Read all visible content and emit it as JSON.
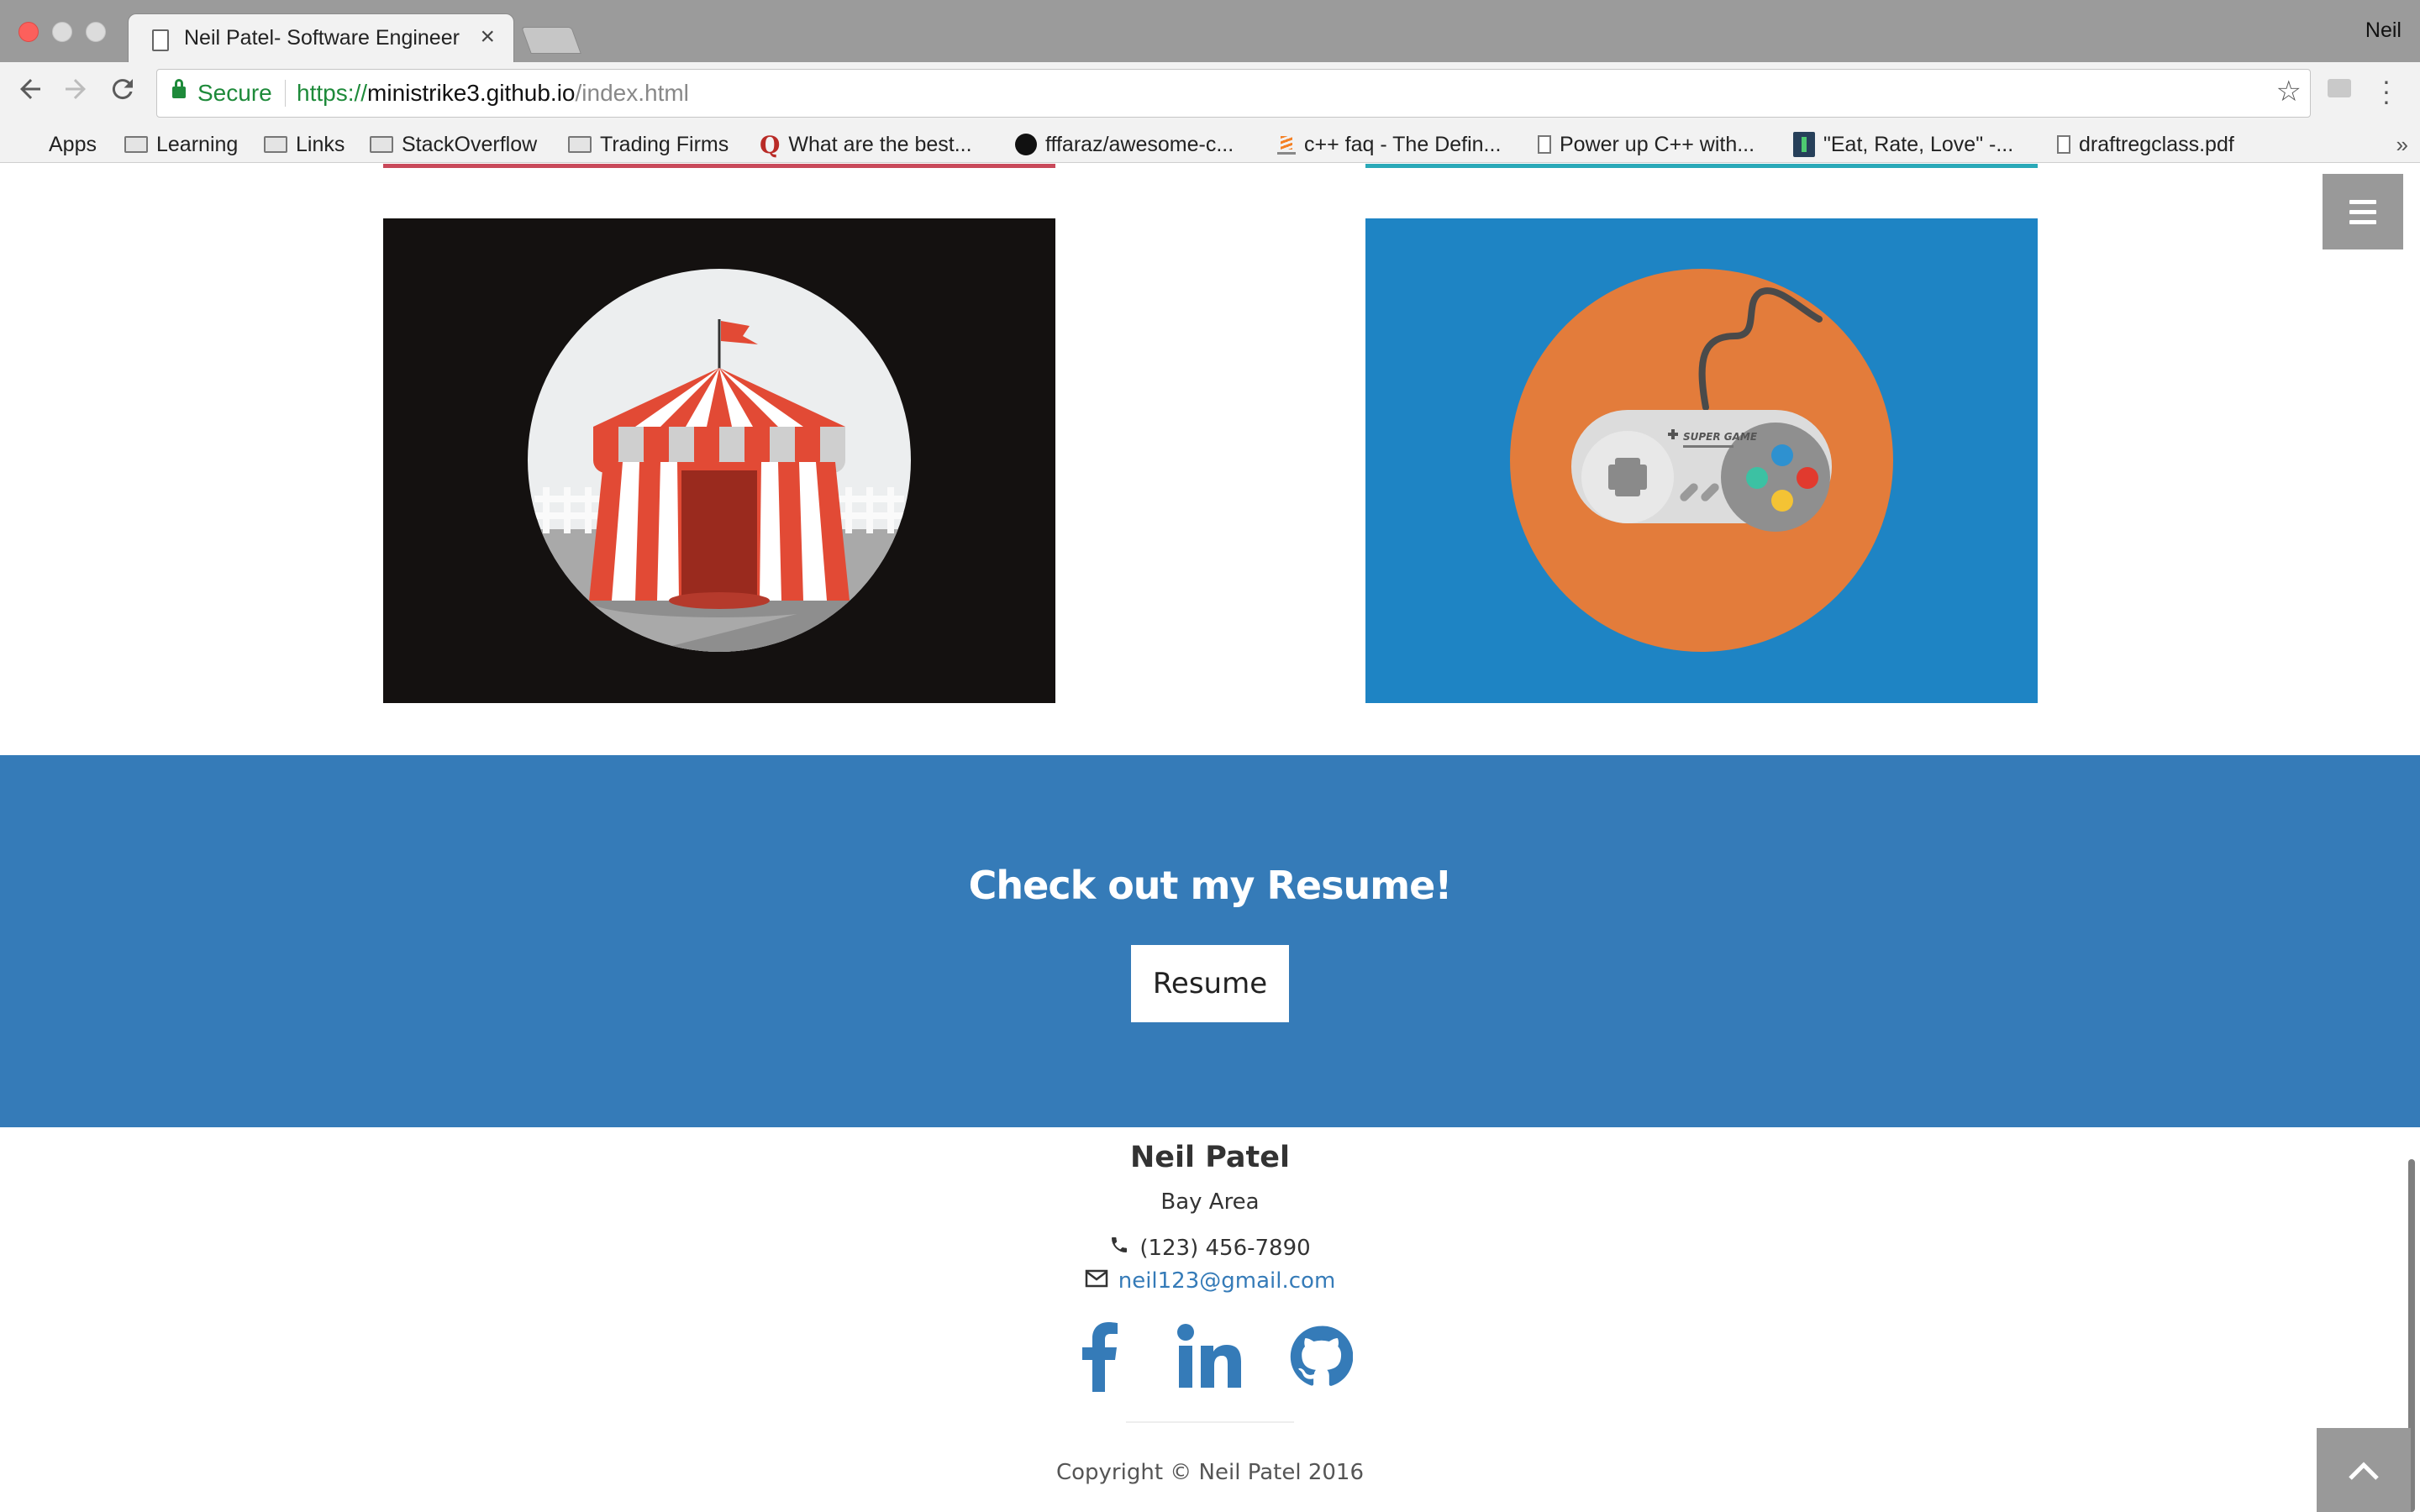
{
  "browser": {
    "tab_title": "Neil Patel- Software Engineer",
    "tab_close": "×",
    "profile_name": "Neil",
    "secure_label": "Secure",
    "url_scheme": "https://",
    "url_host": "ministrike3.github.io",
    "url_path": "/index.html",
    "bookmarks": [
      {
        "label": "Apps",
        "icon": "apps-grid-icon"
      },
      {
        "label": "Learning",
        "icon": "folder-icon"
      },
      {
        "label": "Links",
        "icon": "folder-icon"
      },
      {
        "label": "StackOverflow",
        "icon": "folder-icon"
      },
      {
        "label": "Trading Firms",
        "icon": "folder-icon"
      },
      {
        "label": "What are the best...",
        "icon": "quora-icon"
      },
      {
        "label": "fffaraz/awesome-c...",
        "icon": "github-icon"
      },
      {
        "label": "c++ faq - The Defin...",
        "icon": "stackoverflow-icon"
      },
      {
        "label": "Power up C++ with...",
        "icon": "page-icon"
      },
      {
        "label": "\"Eat, Rate, Love\" -...",
        "icon": "vine-icon"
      },
      {
        "label": "draftregclass.pdf",
        "icon": "page-icon"
      }
    ],
    "overflow": "»"
  },
  "portfolio": {
    "tiles": [
      {
        "name": "circus-tent-tile",
        "bg": "#141110",
        "accent": "#c9495a"
      },
      {
        "name": "game-controller-tile",
        "bg": "#1e84c4",
        "accent": "#2aa9b8"
      }
    ],
    "controller_brand": "SUPER GAME"
  },
  "resume": {
    "heading": "Check out my Resume!",
    "button_label": "Resume",
    "bg": "#357bb8"
  },
  "footer": {
    "name": "Neil Patel",
    "location": "Bay Area",
    "phone": "(123) 456-7890",
    "email": "neil123@gmail.com",
    "social": [
      "facebook-icon",
      "linkedin-icon",
      "github-icon"
    ],
    "copyright": "Copyright © Neil Patel 2016"
  }
}
